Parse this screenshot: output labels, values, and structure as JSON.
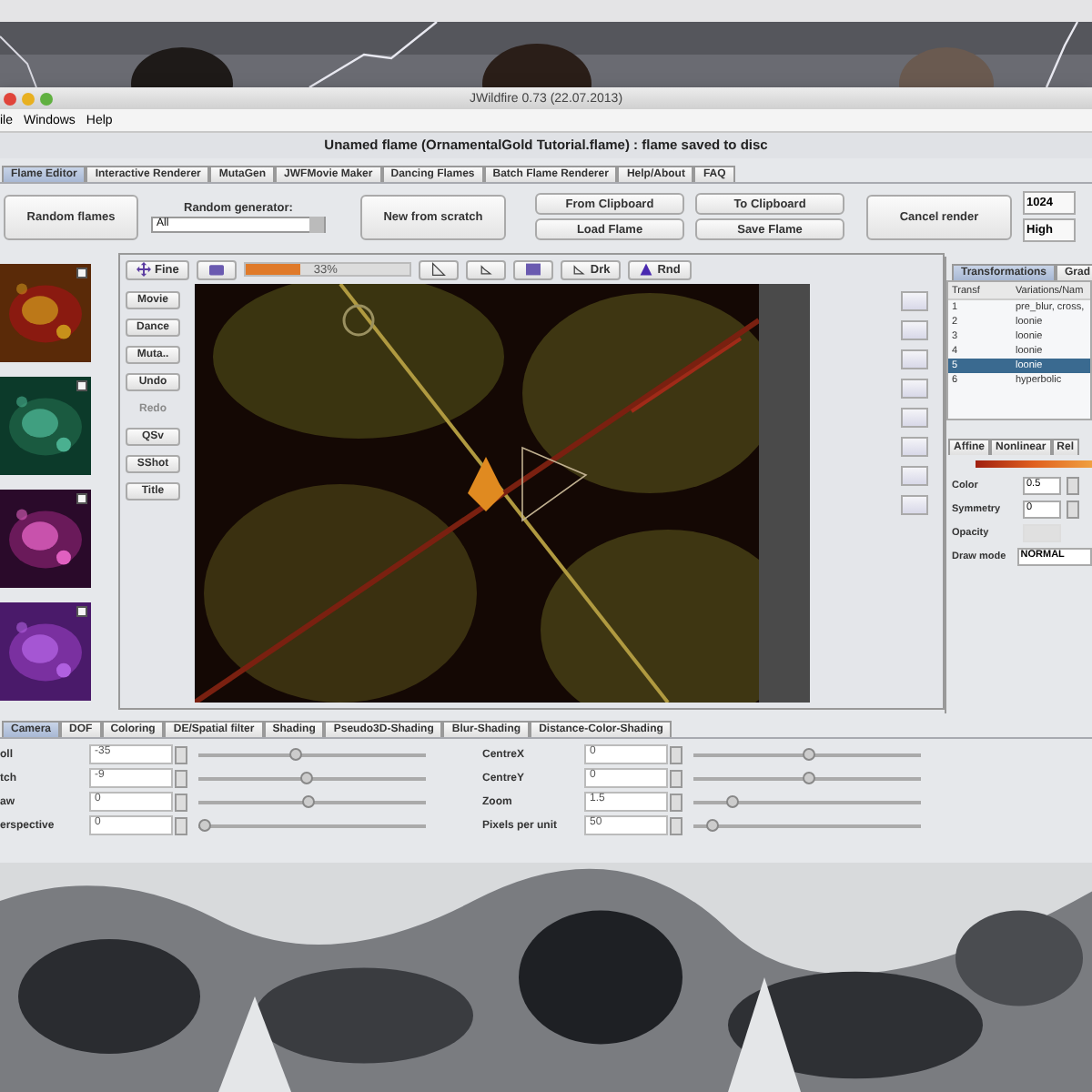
{
  "window": {
    "title": "JWildfire 0.73 (22.07.2013)"
  },
  "menu": [
    "ile",
    "Windows",
    "Help"
  ],
  "status": "Unamed flame (OrnamentalGold Tutorial.flame) : flame saved to disc",
  "tabs": [
    {
      "label": "Flame Editor",
      "selected": true
    },
    {
      "label": "Interactive Renderer",
      "selected": false
    },
    {
      "label": "MutaGen",
      "selected": false
    },
    {
      "label": "JWFMovie Maker",
      "selected": false
    },
    {
      "label": "Dancing Flames",
      "selected": false
    },
    {
      "label": "Batch Flame Renderer",
      "selected": false
    },
    {
      "label": "Help/About",
      "selected": false
    },
    {
      "label": "FAQ",
      "selected": false
    }
  ],
  "toolbar": {
    "random_flames": "Random flames",
    "generator_label": "Random generator:",
    "generator_value": "All",
    "new_flame": "New from scratch",
    "from_clipboard": "From Clipboard",
    "to_clipboard": "To Clipboard",
    "load": "Load Flame",
    "save": "Save Flame",
    "cancel": "Cancel render",
    "size": "1024",
    "quality": "High"
  },
  "preview_toolbar": {
    "fine": "Fine",
    "progress": {
      "level": 0.33,
      "reading": "33%"
    },
    "dark": "Drk",
    "random": "Rnd"
  },
  "side_buttons": [
    {
      "label": "Movie",
      "disabled": false
    },
    {
      "label": "Dance",
      "disabled": false
    },
    {
      "label": "Muta..",
      "disabled": false
    },
    {
      "label": "Undo",
      "disabled": false
    },
    {
      "label": "Redo",
      "disabled": true
    },
    {
      "label": "QSv",
      "disabled": false
    },
    {
      "label": "SShot",
      "disabled": false
    },
    {
      "label": "Title",
      "disabled": false
    }
  ],
  "transformations": {
    "tabs": [
      {
        "label": "Transformations",
        "selected": true
      },
      {
        "label": "Grad",
        "selected": false
      }
    ],
    "columns": [
      "Transf",
      "Variations/Nam"
    ],
    "rows": [
      {
        "index": "1",
        "name": "pre_blur, cross,",
        "selected": false
      },
      {
        "index": "2",
        "name": "loonie",
        "selected": false
      },
      {
        "index": "3",
        "name": "loonie",
        "selected": false
      },
      {
        "index": "4",
        "name": "loonie",
        "selected": false
      },
      {
        "index": "5",
        "name": "loonie",
        "selected": true
      },
      {
        "index": "6",
        "name": "hyperbolic",
        "selected": false
      }
    ]
  },
  "xform_tabs": [
    "Affine",
    "Nonlinear",
    "Rel"
  ],
  "properties": [
    {
      "label": "Color",
      "kind": "spinner",
      "value": "0.5"
    },
    {
      "label": "Symmetry",
      "kind": "spinner",
      "value": "0"
    },
    {
      "label": "Opacity",
      "kind": "disabled"
    },
    {
      "label": "Draw mode",
      "kind": "select",
      "value": "NORMAL"
    }
  ],
  "bottom_tabs": [
    {
      "label": "Camera",
      "selected": true
    },
    {
      "label": "DOF",
      "selected": false
    },
    {
      "label": "Coloring",
      "selected": false
    },
    {
      "label": "DE/Spatial filter",
      "selected": false
    },
    {
      "label": "Shading",
      "selected": false
    },
    {
      "label": "Pseudo3D-Shading",
      "selected": false
    },
    {
      "label": "Blur-Shading",
      "selected": false
    },
    {
      "label": "Distance-Color-Shading",
      "selected": false
    }
  ],
  "params_left": [
    {
      "label": "oll",
      "value": "-35",
      "level": 0.42
    },
    {
      "label": "tch",
      "value": "-9",
      "level": 0.47
    },
    {
      "label": "aw",
      "value": "0",
      "level": 0.48
    },
    {
      "label": "erspective",
      "value": "0",
      "level": 0.02
    }
  ],
  "params_right": [
    {
      "label": "CentreX",
      "value": "0",
      "level": 0.5
    },
    {
      "label": "CentreY",
      "value": "0",
      "level": 0.5
    },
    {
      "label": "Zoom",
      "value": "1.5",
      "level": 0.17
    },
    {
      "label": "Pixels per unit",
      "value": "50",
      "level": 0.08
    }
  ]
}
